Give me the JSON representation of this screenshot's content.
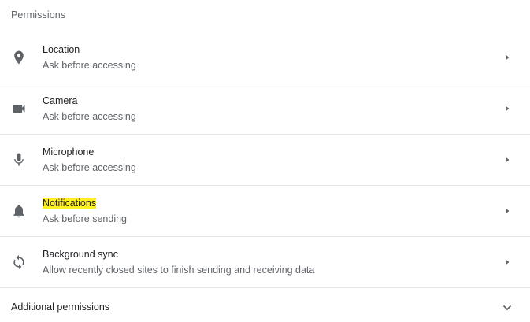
{
  "section": {
    "title": "Permissions"
  },
  "permissions": [
    {
      "icon": "location-pin-icon",
      "name": "Location",
      "description": "Ask before accessing"
    },
    {
      "icon": "camera-icon",
      "name": "Camera",
      "description": "Ask before accessing"
    },
    {
      "icon": "microphone-icon",
      "name": "Microphone",
      "description": "Ask before accessing"
    },
    {
      "icon": "bell-icon",
      "name": "Notifications",
      "description": "Ask before sending",
      "highlighted": true,
      "highlight_color": "#fff01f"
    },
    {
      "icon": "sync-icon",
      "name": "Background sync",
      "description": "Allow recently closed sites to finish sending and receiving data"
    }
  ],
  "additional": {
    "label": "Additional permissions",
    "icon": "chevron-down-icon"
  },
  "colors": {
    "icon": "#5f6368",
    "primary_text": "#202124",
    "secondary_text": "#5f6368",
    "divider": "#e4e4e4"
  }
}
